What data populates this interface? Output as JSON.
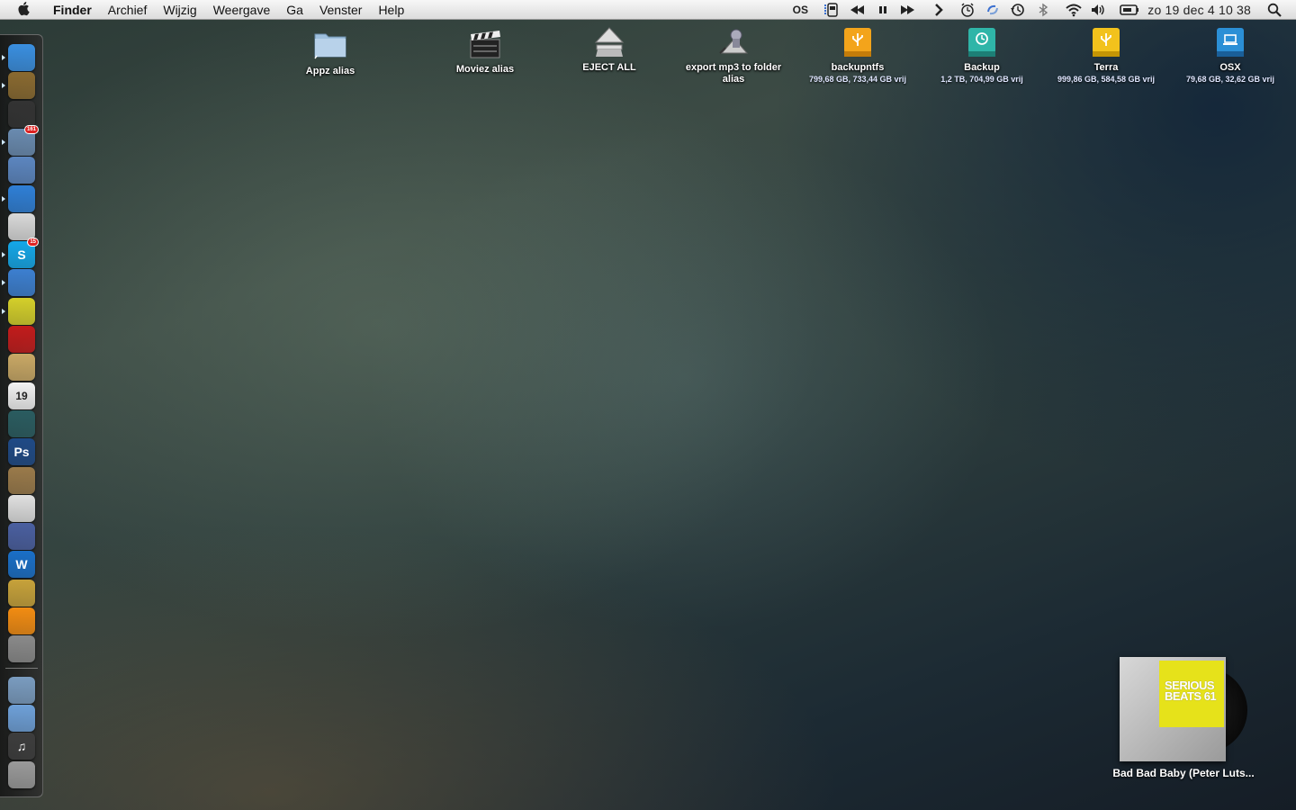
{
  "menubar": {
    "app_name": "Finder",
    "items": [
      "Archief",
      "Wijzig",
      "Weergave",
      "Ga",
      "Venster",
      "Help"
    ],
    "status": {
      "os_label": "OS",
      "clock": "zo 19 dec  4 10 38"
    },
    "status_icons": [
      "battery-monitor-icon",
      "rewind-icon",
      "pause-icon",
      "fast-forward-icon",
      "chevron-right-icon",
      "alarm-clock-icon",
      "sync-icon",
      "time-machine-icon",
      "bluetooth-icon",
      "wifi-icon",
      "volume-icon",
      "display-icon",
      "spotlight-icon"
    ]
  },
  "desktop": {
    "icons": [
      {
        "label": "Appz alias",
        "sub": "",
        "icon": "folder-icon"
      },
      {
        "label": "Moviez alias",
        "sub": "",
        "icon": "clapper-icon"
      },
      {
        "label": "EJECT ALL",
        "sub": "",
        "icon": "eject-icon"
      },
      {
        "label": "export mp3 to folder alias",
        "sub": "",
        "icon": "automator-icon"
      },
      {
        "label": "backupntfs",
        "sub": "799,68 GB, 733,44 GB vrij",
        "icon": "usb-drive-icon"
      },
      {
        "label": "Backup",
        "sub": "1,2 TB, 704,99 GB vrij",
        "icon": "time-machine-drive-icon"
      },
      {
        "label": "Terra",
        "sub": "999,86 GB, 584,58 GB vrij",
        "icon": "usb-drive-icon"
      },
      {
        "label": "OSX",
        "sub": "79,68 GB, 32,62 GB vrij",
        "icon": "internal-drive-icon"
      }
    ]
  },
  "dock": {
    "items": [
      {
        "name": "finder",
        "glyph": "",
        "color": "#3a8fe0",
        "badge": "",
        "running": true
      },
      {
        "name": "spaceship",
        "glyph": "",
        "color": "#8a6a30",
        "badge": "",
        "running": true
      },
      {
        "name": "dashboard",
        "glyph": "",
        "color": "#333333",
        "badge": "",
        "running": false
      },
      {
        "name": "mail",
        "glyph": "",
        "color": "#6a8bb0",
        "badge": "161",
        "running": true
      },
      {
        "name": "preview",
        "glyph": "",
        "color": "#5c86c0",
        "badge": "",
        "running": false
      },
      {
        "name": "safari",
        "glyph": "",
        "color": "#2f7fd6",
        "badge": "",
        "running": true
      },
      {
        "name": "adium",
        "glyph": "",
        "color": "#d9d9d9",
        "badge": "",
        "running": false
      },
      {
        "name": "skype",
        "glyph": "S",
        "color": "#14a7e8",
        "badge": "15",
        "running": true
      },
      {
        "name": "itunes",
        "glyph": "",
        "color": "#3c7fd0",
        "badge": "",
        "running": true
      },
      {
        "name": "stickies",
        "glyph": "",
        "color": "#d4cf2a",
        "badge": "",
        "running": true
      },
      {
        "name": "transmit",
        "glyph": "",
        "color": "#c21b1b",
        "badge": "",
        "running": false
      },
      {
        "name": "address-book",
        "glyph": "",
        "color": "#c9a865",
        "badge": "",
        "running": false
      },
      {
        "name": "ical",
        "glyph": "19",
        "color": "#f2f2f2",
        "badge": "",
        "running": false
      },
      {
        "name": "time-machine",
        "glyph": "",
        "color": "#2a5c60",
        "badge": "",
        "running": false
      },
      {
        "name": "photoshop",
        "glyph": "Ps",
        "color": "#1f4a86",
        "badge": "",
        "running": false
      },
      {
        "name": "iphoto",
        "glyph": "",
        "color": "#9a7a4a",
        "badge": "",
        "running": false
      },
      {
        "name": "textedit",
        "glyph": "",
        "color": "#e0e0e0",
        "badge": "",
        "running": false
      },
      {
        "name": "script-editor",
        "glyph": "",
        "color": "#4a5fa0",
        "badge": "",
        "running": false
      },
      {
        "name": "word",
        "glyph": "W",
        "color": "#1a6fc7",
        "badge": "",
        "running": false
      },
      {
        "name": "imovie",
        "glyph": "",
        "color": "#c7a23a",
        "badge": "",
        "running": false
      },
      {
        "name": "vlc",
        "glyph": "",
        "color": "#f28c12",
        "badge": "",
        "running": false
      },
      {
        "name": "system-preferences",
        "glyph": "",
        "color": "#8a8a8a",
        "badge": "",
        "running": false
      },
      {
        "name": "applications-stack",
        "glyph": "",
        "color": "#7a9cc0",
        "badge": "",
        "running": false
      },
      {
        "name": "documents-stack",
        "glyph": "",
        "color": "#6ea0d8",
        "badge": "",
        "running": false
      },
      {
        "name": "music-stack",
        "glyph": "♫",
        "color": "#3d3d3d",
        "badge": "",
        "running": false
      },
      {
        "name": "trash",
        "glyph": "",
        "color": "#9a9a9a",
        "badge": "",
        "running": false
      }
    ]
  },
  "now_playing": {
    "track": "Bad Bad Baby (Peter Luts...",
    "cover_text_1": "SERIOUS",
    "cover_text_2": "BEATS 61"
  }
}
